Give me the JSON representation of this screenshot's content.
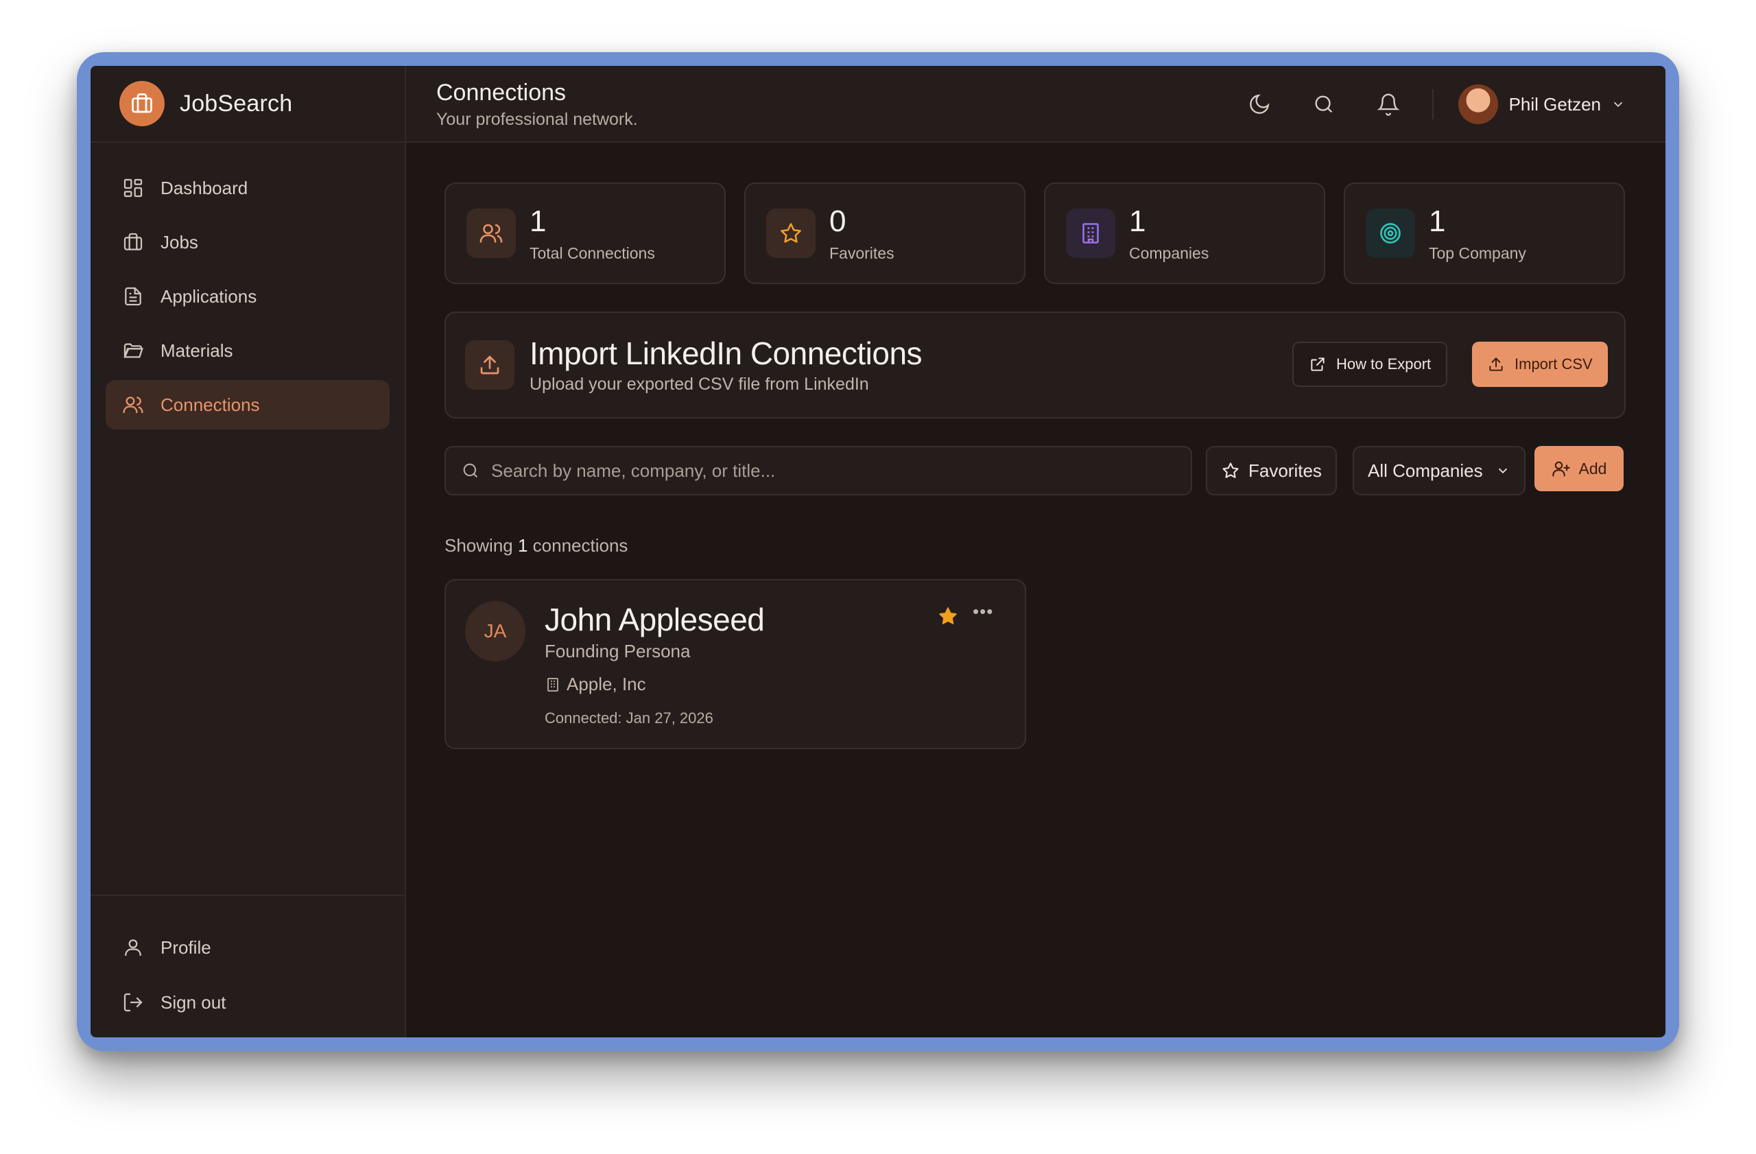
{
  "brand": {
    "name": "JobSearch"
  },
  "sidebar": {
    "items": [
      {
        "label": "Dashboard",
        "icon": "dashboard-icon"
      },
      {
        "label": "Jobs",
        "icon": "briefcase-icon"
      },
      {
        "label": "Applications",
        "icon": "document-icon"
      },
      {
        "label": "Materials",
        "icon": "folder-icon"
      },
      {
        "label": "Connections",
        "icon": "users-icon",
        "active": true
      }
    ],
    "bottom": [
      {
        "label": "Profile",
        "icon": "user-icon"
      },
      {
        "label": "Sign out",
        "icon": "logout-icon"
      }
    ]
  },
  "header": {
    "title": "Connections",
    "subtitle": "Your professional network.",
    "user_name": "Phil Getzen"
  },
  "stats": [
    {
      "value": "1",
      "label": "Total Connections",
      "icon": "users-icon"
    },
    {
      "value": "0",
      "label": "Favorites",
      "icon": "star-icon"
    },
    {
      "value": "1",
      "label": "Companies",
      "icon": "building-icon"
    },
    {
      "value": "1",
      "label": "Top Company",
      "icon": "target-icon"
    }
  ],
  "import": {
    "title": "Import LinkedIn Connections",
    "subtitle": "Upload your exported CSV file from LinkedIn",
    "how_label": "How to Export",
    "import_label": "Import CSV"
  },
  "filters": {
    "search_placeholder": "Search by name, company, or title...",
    "favorites_label": "Favorites",
    "company_label": "All Companies",
    "add_label": "Add"
  },
  "results": {
    "prefix": "Showing",
    "count": "1",
    "suffix": "connections"
  },
  "connections": [
    {
      "initials": "JA",
      "name": "John Appleseed",
      "title": "Founding Persona",
      "company": "Apple, Inc",
      "connected": "Connected: Jan 27, 2026",
      "favorite": true
    }
  ],
  "colors": {
    "accent": "#e99468",
    "background": "#1d1615",
    "panel": "#251d1b",
    "frame": "#6f8fd3"
  }
}
